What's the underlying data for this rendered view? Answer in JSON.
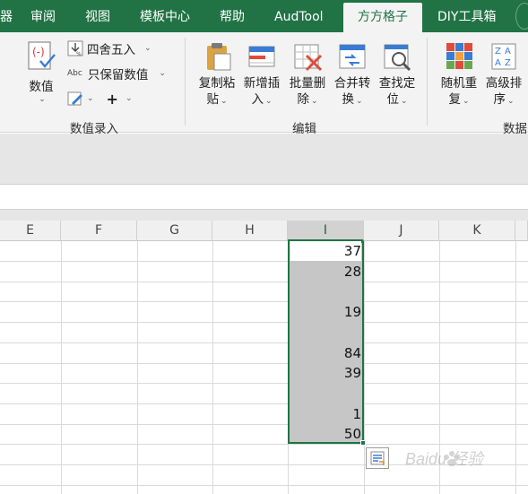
{
  "tabs": [
    {
      "label": "审阅"
    },
    {
      "label": "视图"
    },
    {
      "label": "模板中心"
    },
    {
      "label": "帮助"
    },
    {
      "label": "AudTool"
    },
    {
      "label": "方方格子",
      "active": true
    },
    {
      "label": "DIY工具箱"
    }
  ],
  "tab_partial_left": "器",
  "ribbon": {
    "value_entry": {
      "big_button": {
        "label": "数值"
      },
      "small_buttons": [
        {
          "label": "四舍五入"
        },
        {
          "label": "只保留数值"
        },
        {
          "label": "+"
        }
      ],
      "group_label": "数值录入"
    },
    "edit": {
      "buttons": [
        {
          "line1": "复制粘",
          "line2": "贴"
        },
        {
          "line1": "新增插",
          "line2": "入"
        },
        {
          "line1": "批量删",
          "line2": "除"
        },
        {
          "line1": "合并转",
          "line2": "换"
        },
        {
          "line1": "查找定",
          "line2": "位"
        }
      ],
      "group_label": "编辑"
    },
    "data": {
      "buttons": [
        {
          "line1": "随机重",
          "line2": "复"
        },
        {
          "line1": "高级排",
          "line2": "序"
        }
      ],
      "group_label_partial": "数据"
    },
    "icons": {
      "value": "number-format-icon",
      "round": "round-icon",
      "abc": "text-abc-icon",
      "edit_small": "pencil-icon",
      "copy_paste": "clipboard-icon",
      "insert": "insert-row-icon",
      "delete": "delete-table-icon",
      "merge": "merge-convert-icon",
      "find": "magnifier-icon",
      "random": "color-grid-icon",
      "sort": "sort-az-icon"
    }
  },
  "columns": [
    "E",
    "F",
    "G",
    "H",
    "I",
    "J",
    "K"
  ],
  "selected_column": "I",
  "cells_I": [
    "37",
    "28",
    "",
    "19",
    "",
    "84",
    "39",
    "",
    "1",
    "50"
  ],
  "colors": {
    "accent": "#217346",
    "selection": "#c6c6c6",
    "ribbon_bg": "#f3f3f3"
  },
  "watermark": "Baidu 经验"
}
